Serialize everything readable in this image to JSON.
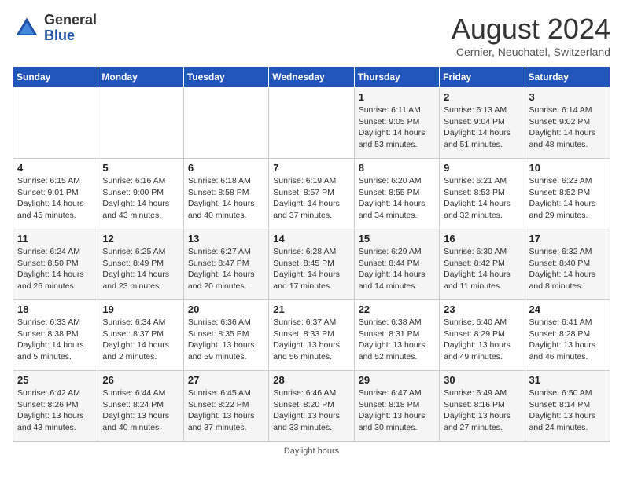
{
  "header": {
    "logo_general": "General",
    "logo_blue": "Blue",
    "month_title": "August 2024",
    "location": "Cernier, Neuchatel, Switzerland"
  },
  "days_of_week": [
    "Sunday",
    "Monday",
    "Tuesday",
    "Wednesday",
    "Thursday",
    "Friday",
    "Saturday"
  ],
  "weeks": [
    [
      {
        "day": "",
        "info": ""
      },
      {
        "day": "",
        "info": ""
      },
      {
        "day": "",
        "info": ""
      },
      {
        "day": "",
        "info": ""
      },
      {
        "day": "1",
        "info": "Sunrise: 6:11 AM\nSunset: 9:05 PM\nDaylight: 14 hours\nand 53 minutes."
      },
      {
        "day": "2",
        "info": "Sunrise: 6:13 AM\nSunset: 9:04 PM\nDaylight: 14 hours\nand 51 minutes."
      },
      {
        "day": "3",
        "info": "Sunrise: 6:14 AM\nSunset: 9:02 PM\nDaylight: 14 hours\nand 48 minutes."
      }
    ],
    [
      {
        "day": "4",
        "info": "Sunrise: 6:15 AM\nSunset: 9:01 PM\nDaylight: 14 hours\nand 45 minutes."
      },
      {
        "day": "5",
        "info": "Sunrise: 6:16 AM\nSunset: 9:00 PM\nDaylight: 14 hours\nand 43 minutes."
      },
      {
        "day": "6",
        "info": "Sunrise: 6:18 AM\nSunset: 8:58 PM\nDaylight: 14 hours\nand 40 minutes."
      },
      {
        "day": "7",
        "info": "Sunrise: 6:19 AM\nSunset: 8:57 PM\nDaylight: 14 hours\nand 37 minutes."
      },
      {
        "day": "8",
        "info": "Sunrise: 6:20 AM\nSunset: 8:55 PM\nDaylight: 14 hours\nand 34 minutes."
      },
      {
        "day": "9",
        "info": "Sunrise: 6:21 AM\nSunset: 8:53 PM\nDaylight: 14 hours\nand 32 minutes."
      },
      {
        "day": "10",
        "info": "Sunrise: 6:23 AM\nSunset: 8:52 PM\nDaylight: 14 hours\nand 29 minutes."
      }
    ],
    [
      {
        "day": "11",
        "info": "Sunrise: 6:24 AM\nSunset: 8:50 PM\nDaylight: 14 hours\nand 26 minutes."
      },
      {
        "day": "12",
        "info": "Sunrise: 6:25 AM\nSunset: 8:49 PM\nDaylight: 14 hours\nand 23 minutes."
      },
      {
        "day": "13",
        "info": "Sunrise: 6:27 AM\nSunset: 8:47 PM\nDaylight: 14 hours\nand 20 minutes."
      },
      {
        "day": "14",
        "info": "Sunrise: 6:28 AM\nSunset: 8:45 PM\nDaylight: 14 hours\nand 17 minutes."
      },
      {
        "day": "15",
        "info": "Sunrise: 6:29 AM\nSunset: 8:44 PM\nDaylight: 14 hours\nand 14 minutes."
      },
      {
        "day": "16",
        "info": "Sunrise: 6:30 AM\nSunset: 8:42 PM\nDaylight: 14 hours\nand 11 minutes."
      },
      {
        "day": "17",
        "info": "Sunrise: 6:32 AM\nSunset: 8:40 PM\nDaylight: 14 hours\nand 8 minutes."
      }
    ],
    [
      {
        "day": "18",
        "info": "Sunrise: 6:33 AM\nSunset: 8:38 PM\nDaylight: 14 hours\nand 5 minutes."
      },
      {
        "day": "19",
        "info": "Sunrise: 6:34 AM\nSunset: 8:37 PM\nDaylight: 14 hours\nand 2 minutes."
      },
      {
        "day": "20",
        "info": "Sunrise: 6:36 AM\nSunset: 8:35 PM\nDaylight: 13 hours\nand 59 minutes."
      },
      {
        "day": "21",
        "info": "Sunrise: 6:37 AM\nSunset: 8:33 PM\nDaylight: 13 hours\nand 56 minutes."
      },
      {
        "day": "22",
        "info": "Sunrise: 6:38 AM\nSunset: 8:31 PM\nDaylight: 13 hours\nand 52 minutes."
      },
      {
        "day": "23",
        "info": "Sunrise: 6:40 AM\nSunset: 8:29 PM\nDaylight: 13 hours\nand 49 minutes."
      },
      {
        "day": "24",
        "info": "Sunrise: 6:41 AM\nSunset: 8:28 PM\nDaylight: 13 hours\nand 46 minutes."
      }
    ],
    [
      {
        "day": "25",
        "info": "Sunrise: 6:42 AM\nSunset: 8:26 PM\nDaylight: 13 hours\nand 43 minutes."
      },
      {
        "day": "26",
        "info": "Sunrise: 6:44 AM\nSunset: 8:24 PM\nDaylight: 13 hours\nand 40 minutes."
      },
      {
        "day": "27",
        "info": "Sunrise: 6:45 AM\nSunset: 8:22 PM\nDaylight: 13 hours\nand 37 minutes."
      },
      {
        "day": "28",
        "info": "Sunrise: 6:46 AM\nSunset: 8:20 PM\nDaylight: 13 hours\nand 33 minutes."
      },
      {
        "day": "29",
        "info": "Sunrise: 6:47 AM\nSunset: 8:18 PM\nDaylight: 13 hours\nand 30 minutes."
      },
      {
        "day": "30",
        "info": "Sunrise: 6:49 AM\nSunset: 8:16 PM\nDaylight: 13 hours\nand 27 minutes."
      },
      {
        "day": "31",
        "info": "Sunrise: 6:50 AM\nSunset: 8:14 PM\nDaylight: 13 hours\nand 24 minutes."
      }
    ]
  ],
  "footer": {
    "note": "Daylight hours"
  }
}
